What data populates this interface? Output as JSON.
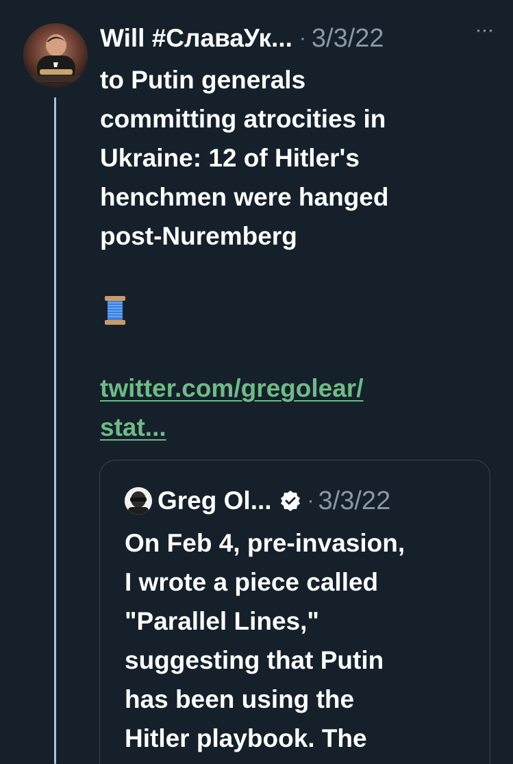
{
  "tweet": {
    "author_name": "Will #СлаваУк...",
    "separator": "·",
    "date": "3/3/22",
    "more_icon": "···",
    "text": "to Putin generals\ncommitting atrocities in\nUkraine: 12 of Hitler's\nhenchmen were hanged\npost-Nuremberg",
    "emoji": "spool-of-thread",
    "link_text": "twitter.com/gregolear/\nstat..."
  },
  "quote": {
    "author_name": "Greg Ol...",
    "verified": true,
    "separator": "·",
    "date": "3/3/22",
    "text": "On Feb 4, pre-invasion,\nI wrote a piece called\n\"Parallel Lines,\"\nsuggesting that Putin\nhas been using the\nHitler playbook. The"
  },
  "colors": {
    "background": "#15202b",
    "text": "#ffffff",
    "muted": "#8b98a5",
    "link": "#6fbb86",
    "thread_line": "#a7c6df",
    "card_border": "#38444d"
  },
  "icons": {
    "avatar": "user-avatar",
    "more": "more-options-icon",
    "verified": "verified-badge-icon",
    "quote_avatar": "quoted-user-avatar"
  }
}
